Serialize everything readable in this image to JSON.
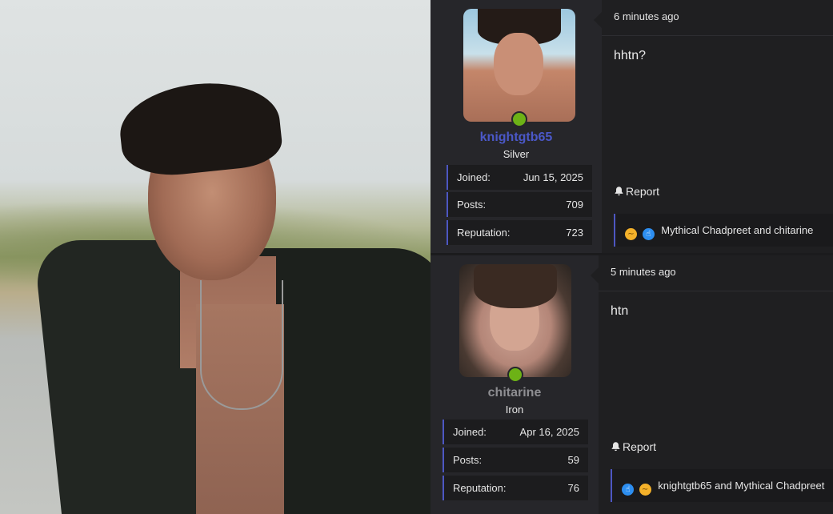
{
  "photo": {
    "description_icon": "photo"
  },
  "posts": [
    {
      "user": {
        "name": "knightgtb65",
        "rank": "Silver",
        "name_color": "#4b58c8"
      },
      "stats": [
        {
          "label": "Joined:",
          "value": "Jun 15, 2025"
        },
        {
          "label": "Posts:",
          "value": "709"
        },
        {
          "label": "Reputation:",
          "value": "723"
        }
      ],
      "time": "6 minutes ago",
      "body": "hhtn?",
      "report_label": "Report",
      "reactions": {
        "icons": [
          "confused-icon",
          "like-icon"
        ],
        "names": "Mythical Chadpreet and chitarine"
      }
    },
    {
      "user": {
        "name": "chitarine",
        "rank": "Iron",
        "name_color": "#8e8e92"
      },
      "stats": [
        {
          "label": "Joined:",
          "value": "Apr 16, 2025"
        },
        {
          "label": "Posts:",
          "value": "59"
        },
        {
          "label": "Reputation:",
          "value": "76"
        }
      ],
      "time": "5 minutes ago",
      "body": "htn",
      "report_label": "Report",
      "reactions": {
        "icons": [
          "like-icon",
          "confused-icon"
        ],
        "names": "knightgtb65 and Mythical Chadpreet"
      }
    }
  ],
  "colors": {
    "accent": "#4d57c2",
    "online": "#6db216",
    "background": "#1f1f21"
  }
}
